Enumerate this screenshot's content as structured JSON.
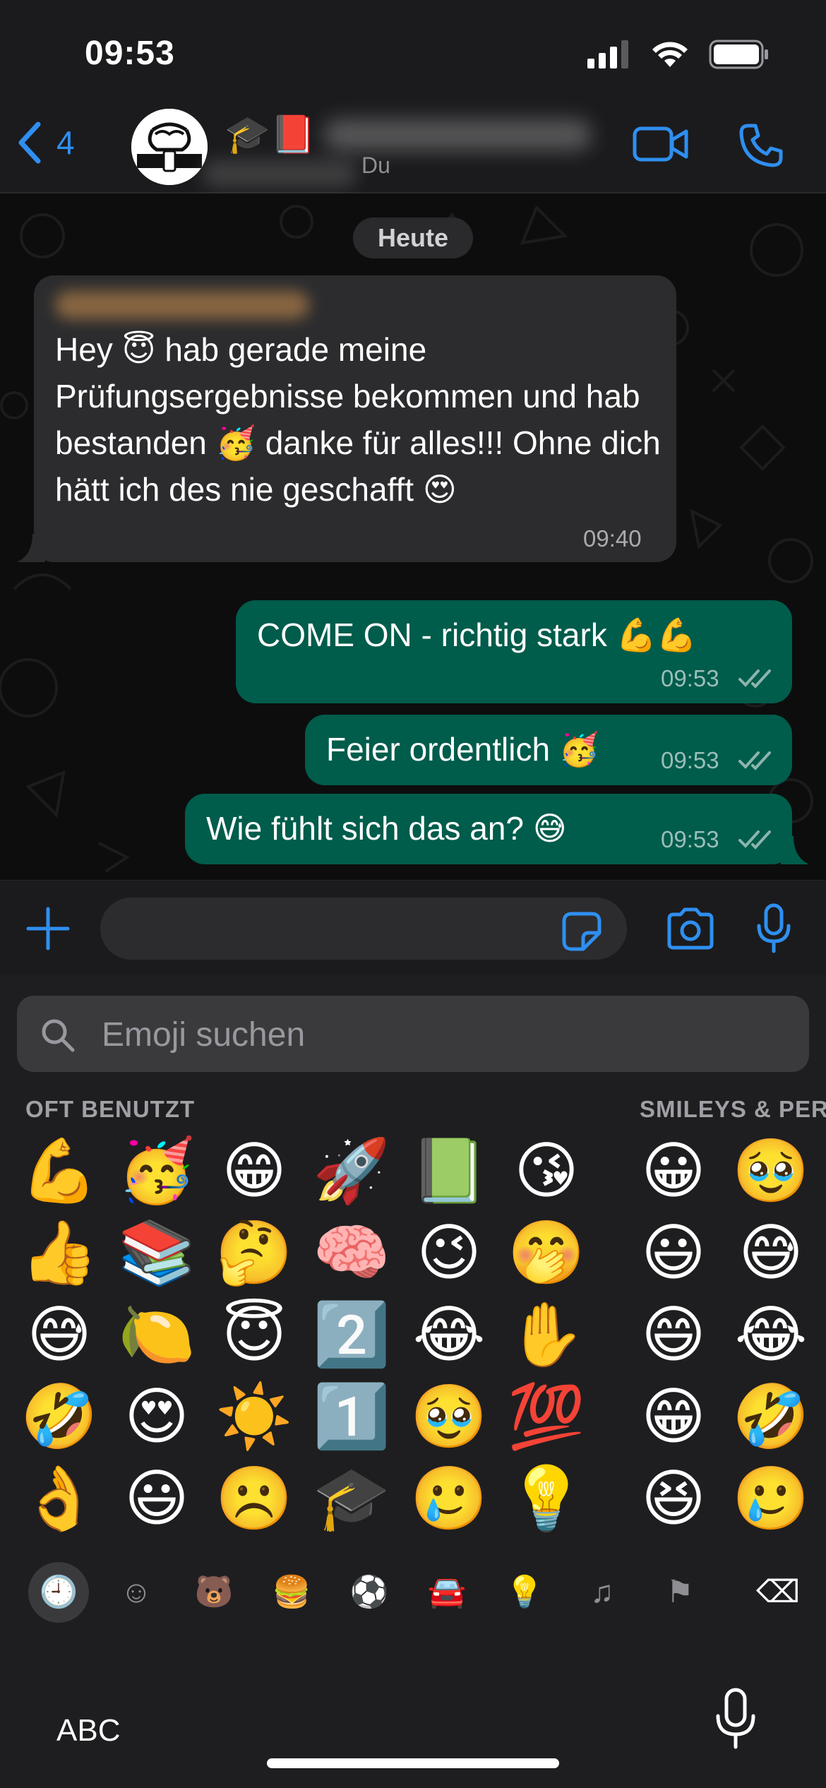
{
  "status_bar": {
    "time": "09:53"
  },
  "header": {
    "back_count": "4",
    "name_emojis": "🎓📕",
    "subtitle": "Du"
  },
  "chat": {
    "date_label": "Heute",
    "messages": [
      {
        "direction": "in",
        "text": "Hey 😇 hab gerade meine Prüfungsergebnisse bekommen und hab bestanden 🥳 danke für alles!!! Ohne dich hätt ich des nie geschafft 😍",
        "time": "09:40"
      },
      {
        "direction": "out",
        "text": "COME ON - richtig stark 💪💪",
        "time": "09:53"
      },
      {
        "direction": "out",
        "text": "Feier ordentlich 🥳",
        "time": "09:53"
      },
      {
        "direction": "out",
        "text": "Wie fühlt sich das an? 😅",
        "time": "09:53"
      }
    ]
  },
  "keyboard": {
    "search_placeholder": "Emoji suchen",
    "section_frequent": "OFT BENUTZT",
    "section_smileys": "SMILEYS & PER",
    "frequent": [
      [
        "💪",
        "👍",
        "😅",
        "🤣",
        "👌"
      ],
      [
        "🥳",
        "📚",
        "🍋",
        "😍",
        "😃"
      ],
      [
        "😁",
        "🤔",
        "😇",
        "☀️",
        "☹️"
      ],
      [
        "🚀",
        "🧠",
        "2️⃣",
        "1️⃣",
        "🎓"
      ],
      [
        "📗",
        "😉",
        "😂",
        "🥹",
        "🥲"
      ],
      [
        "😘",
        "🤭",
        "✋",
        "💯",
        "💡"
      ]
    ],
    "smileys": [
      [
        "😀",
        "😃",
        "😄",
        "😁",
        "😆"
      ],
      [
        "🥹",
        "😅",
        "😂",
        "🤣",
        "🥲"
      ]
    ],
    "categories": [
      "🕘",
      "☺",
      "🐻",
      "🍔",
      "⚽",
      "🚘",
      "💡",
      "♫",
      "⚑",
      "⌫"
    ],
    "abc_label": "ABC"
  },
  "colors": {
    "accent": "#2f8ff0",
    "outgoing_bubble": "#005c4b",
    "incoming_bubble": "#2c2c2e"
  }
}
